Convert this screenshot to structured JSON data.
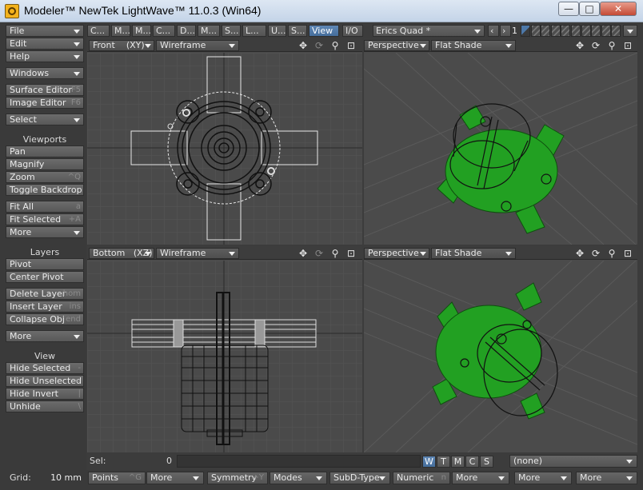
{
  "window": {
    "title": "Modeler™ NewTek LightWave™ 11.0.3 (Win64)",
    "minimize": "—",
    "maximize": "□",
    "close": "✕"
  },
  "toolbar": {
    "file": "File",
    "edit": "Edit",
    "help": "Help",
    "windows": "Windows",
    "surface_editor": {
      "label": "Surface Editor",
      "shortcut": "F5"
    },
    "image_editor": {
      "label": "Image Editor",
      "shortcut": "F6"
    },
    "select": "Select",
    "viewports_header": "Viewports",
    "pan": "Pan",
    "magnify": "Magnify",
    "zoom": {
      "label": "Zoom",
      "shortcut": "^Q"
    },
    "toggle_backdrop": "Toggle Backdrop",
    "fit_all": {
      "label": "Fit All",
      "shortcut": "a"
    },
    "fit_selected": {
      "label": "Fit Selected",
      "shortcut": "+A"
    },
    "more1": "More",
    "layers_header": "Layers",
    "pivot": "Pivot",
    "center_pivot": "Center Pivot",
    "delete_layer": {
      "label": "Delete Layer",
      "shortcut": "hom"
    },
    "insert_layer": {
      "label": "Insert Layer",
      "shortcut": "ins"
    },
    "collapse_obj": {
      "label": "Collapse Obj",
      "shortcut": "end"
    },
    "more2": "More",
    "view_header": "View",
    "hide_selected": {
      "label": "Hide Selected",
      "shortcut": "-"
    },
    "hide_unselected": {
      "label": "Hide Unselected",
      "shortcut": "="
    },
    "hide_invert": {
      "label": "Hide Invert",
      "shortcut": "|"
    },
    "unhide": {
      "label": "Unhide",
      "shortcut": "\\"
    }
  },
  "tabs": [
    "C...",
    "M...",
    "M...",
    "C...",
    "D...",
    "M...",
    "S...",
    "L...",
    "U...",
    "S...",
    "View",
    "I/O"
  ],
  "active_tab": "View",
  "layout_preset": "Erics Quad *",
  "layer_count": "1",
  "viewports": {
    "top_left": {
      "view": "Front",
      "axes": "(XY)",
      "mode": "Wireframe"
    },
    "top_right": {
      "view": "Perspective",
      "mode": "Flat Shade"
    },
    "bottom_left": {
      "view": "Bottom",
      "axes": "(XZ)",
      "mode": "Wireframe"
    },
    "bottom_right": {
      "view": "Perspective",
      "mode": "Flat Shade"
    }
  },
  "colors": {
    "accent": "#4d78a8",
    "mesh_green": "#1f9a1f",
    "viewport_bg": "#4a4a4a",
    "panel_bg": "#3c3c3c"
  },
  "status": {
    "sel_label": "Sel:",
    "sel_value": "0",
    "modes": [
      "W",
      "T",
      "M",
      "C",
      "S"
    ],
    "active_mode": "W",
    "surface": "(none)"
  },
  "bottom_bar": {
    "grid_label": "Grid:",
    "grid_value": "10 mm",
    "points": {
      "label": "Points",
      "shortcut": "^G"
    },
    "more": "More",
    "symmetry": {
      "label": "Symmetry",
      "shortcut": "+Y"
    },
    "modes": "Modes",
    "subd": "SubD-Type",
    "numeric": {
      "label": "Numeric",
      "shortcut": "n"
    }
  }
}
